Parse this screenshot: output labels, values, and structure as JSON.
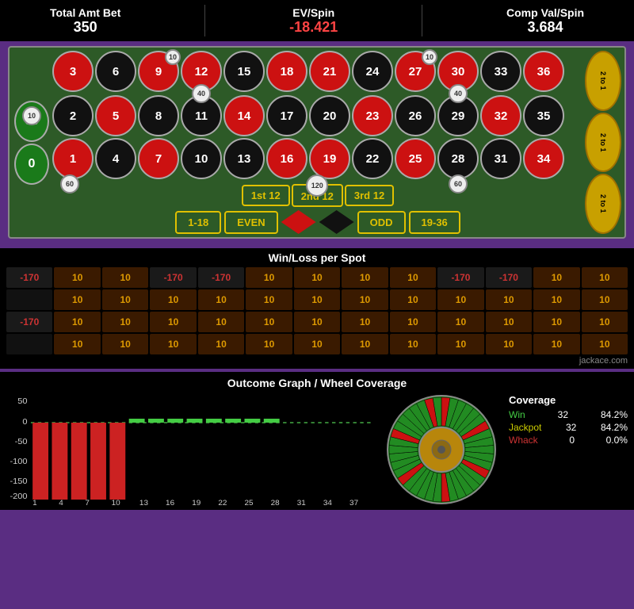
{
  "header": {
    "total_amt_bet_label": "Total Amt Bet",
    "total_amt_bet_value": "350",
    "ev_spin_label": "EV/Spin",
    "ev_spin_value": "-18.421",
    "comp_val_label": "Comp Val/Spin",
    "comp_val_value": "3.684"
  },
  "roulette": {
    "zeros": [
      "00",
      "0"
    ],
    "grid": [
      {
        "num": "3",
        "color": "red"
      },
      {
        "num": "6",
        "color": "black"
      },
      {
        "num": "9",
        "color": "red",
        "chip": "10"
      },
      {
        "num": "12",
        "color": "red"
      },
      {
        "num": "15",
        "color": "black"
      },
      {
        "num": "18",
        "color": "red"
      },
      {
        "num": "21",
        "color": "red"
      },
      {
        "num": "24",
        "color": "black"
      },
      {
        "num": "27",
        "color": "red",
        "chip": "10"
      },
      {
        "num": "30",
        "color": "red"
      },
      {
        "num": "33",
        "color": "black"
      },
      {
        "num": "36",
        "color": "red"
      },
      {
        "num": "2",
        "color": "black",
        "chip_left": "10"
      },
      {
        "num": "5",
        "color": "red"
      },
      {
        "num": "8",
        "color": "black"
      },
      {
        "num": "11",
        "color": "black"
      },
      {
        "num": "14",
        "color": "red"
      },
      {
        "num": "17",
        "color": "black"
      },
      {
        "num": "20",
        "color": "black"
      },
      {
        "num": "23",
        "color": "red"
      },
      {
        "num": "26",
        "color": "black"
      },
      {
        "num": "29",
        "color": "black"
      },
      {
        "num": "32",
        "color": "red"
      },
      {
        "num": "35",
        "color": "black"
      },
      {
        "num": "1",
        "color": "red"
      },
      {
        "num": "4",
        "color": "black"
      },
      {
        "num": "7",
        "color": "red"
      },
      {
        "num": "10",
        "color": "black"
      },
      {
        "num": "13",
        "color": "black"
      },
      {
        "num": "16",
        "color": "red"
      },
      {
        "num": "19",
        "color": "red"
      },
      {
        "num": "22",
        "color": "black"
      },
      {
        "num": "25",
        "color": "red"
      },
      {
        "num": "28",
        "color": "black"
      },
      {
        "num": "31",
        "color": "black"
      },
      {
        "num": "34",
        "color": "red"
      }
    ],
    "chips": {
      "between_row1_row2_col4": "40",
      "between_row2_row3_col10": "40",
      "bottom_left": "60",
      "bottom_right": "60",
      "dozen2_chip": "120"
    },
    "dozens": [
      "1st 12",
      "2nd 12",
      "3rd 12"
    ],
    "bottom_bets": [
      "1-18",
      "EVEN",
      "ODD",
      "19-36"
    ],
    "two_to_one": [
      "2 to 1",
      "2 to 1",
      "2 to 1"
    ]
  },
  "winloss": {
    "title": "Win/Loss per Spot",
    "rows": [
      [
        "-170",
        "10",
        "10",
        "-170",
        "-170",
        "10",
        "10",
        "10",
        "10",
        "-170",
        "-170",
        "10",
        "10"
      ],
      [
        "",
        "10",
        "10",
        "10",
        "10",
        "10",
        "10",
        "10",
        "10",
        "10",
        "10",
        "10",
        "10"
      ],
      [
        "-170",
        "10",
        "10",
        "10",
        "10",
        "10",
        "10",
        "10",
        "10",
        "10",
        "10",
        "10",
        "10"
      ],
      [
        "",
        "10",
        "10",
        "10",
        "10",
        "10",
        "10",
        "10",
        "10",
        "10",
        "10",
        "10",
        "10"
      ]
    ]
  },
  "outcome": {
    "title": "Outcome Graph / Wheel Coverage",
    "chart": {
      "y_labels": [
        "50",
        "0",
        "-50",
        "-100",
        "-150",
        "-200"
      ],
      "x_labels": [
        "1",
        "4",
        "7",
        "10",
        "13",
        "16",
        "19",
        "22",
        "25",
        "28",
        "31",
        "34",
        "37"
      ],
      "bars": [
        -170,
        -170,
        -170,
        -170,
        -170,
        10,
        10,
        10,
        10,
        10,
        10,
        10,
        10
      ]
    },
    "coverage": {
      "title": "Coverage",
      "win_label": "Win",
      "win_count": "32",
      "win_pct": "84.2%",
      "jackpot_label": "Jackpot",
      "jackpot_count": "32",
      "jackpot_pct": "84.2%",
      "whack_label": "Whack",
      "whack_count": "0",
      "whack_pct": "0.0%"
    }
  },
  "footer": {
    "jackace": "jackace.com"
  }
}
